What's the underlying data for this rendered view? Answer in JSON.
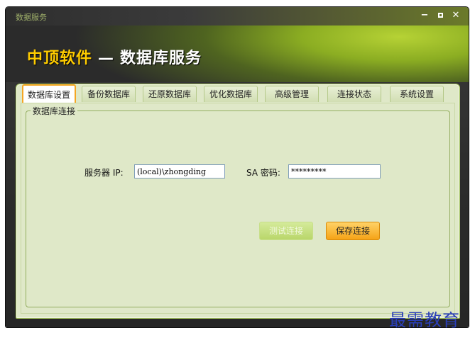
{
  "window": {
    "title": "数据服务",
    "controls": [
      "−",
      "□",
      "✕"
    ]
  },
  "banner": {
    "brand": "中顶软件",
    "separator": "—",
    "name": "数据库服务"
  },
  "tabs": [
    {
      "label": "数据库设置",
      "active": true
    },
    {
      "label": "备份数据库",
      "active": false
    },
    {
      "label": "还原数据库",
      "active": false
    },
    {
      "label": "优化数据库",
      "active": false
    },
    {
      "label": "高级管理",
      "active": false
    },
    {
      "label": "连接状态",
      "active": false
    },
    {
      "label": "系统设置",
      "active": false
    }
  ],
  "connection": {
    "group_title": "数据库连接",
    "server_label": "服务器 IP:",
    "server_value": "(local)\\zhongding",
    "password_label": "SA 密码:",
    "password_value": "*********",
    "test_button": "测试连接",
    "save_button": "保存连接"
  },
  "watermark": "最需教育",
  "colors": {
    "accent": "#f5a623",
    "panel_bg": "#dfe8c8",
    "brand": "#ffcc00",
    "watermark": "#2a3fb8"
  }
}
